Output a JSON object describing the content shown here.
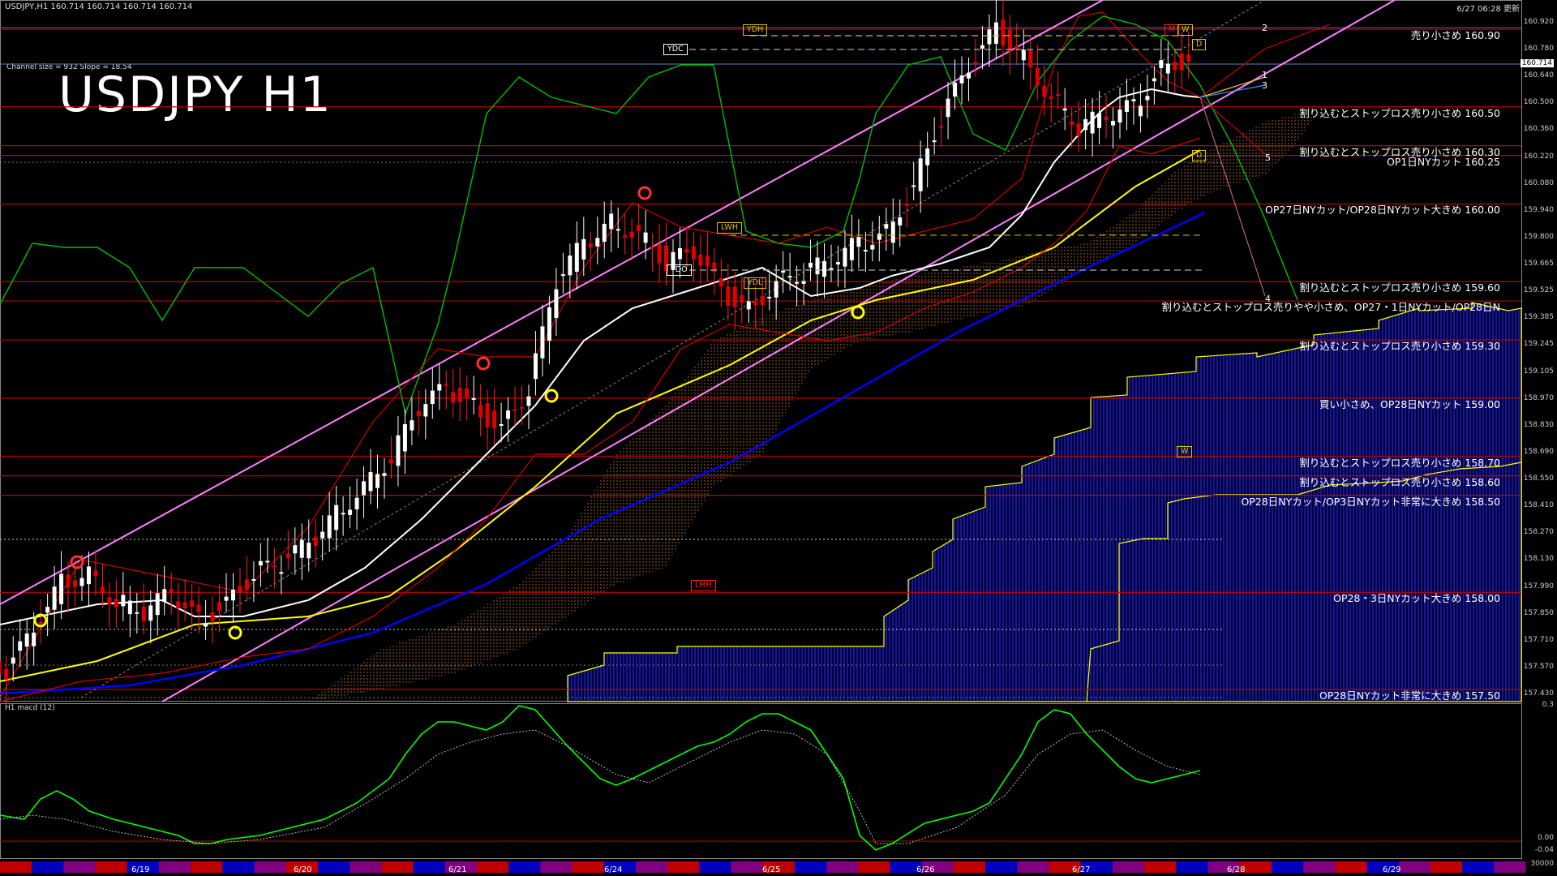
{
  "header": {
    "symbol_line": "USDJPY,H1  160.714 160.714 160.714 160.714",
    "big_title": "USDJPY H1",
    "channel_info": "Channel size = 932 Slope = 18.54",
    "updated": "6/27 06:28 更新"
  },
  "price_axis": {
    "labels": [
      "160.920",
      "160.780",
      "160.640",
      "160.500",
      "160.360",
      "160.220",
      "160.080",
      "159.940",
      "159.800",
      "159.665",
      "159.525",
      "159.385",
      "159.245",
      "159.105",
      "158.970",
      "158.830",
      "158.690",
      "158.550",
      "158.410",
      "158.270",
      "158.130",
      "157.990",
      "157.850",
      "157.710",
      "157.570",
      "157.430"
    ],
    "current": "160.714"
  },
  "macd_axis": {
    "labels": [
      "0.3",
      "0.00",
      "-0.04",
      "30000"
    ]
  },
  "dates": [
    "6/19",
    "6/20",
    "6/21",
    "6/24",
    "6/25",
    "6/26",
    "6/27",
    "6/28",
    "6/29"
  ],
  "levels": [
    {
      "price": 160.9,
      "text": "売り小さめ 160.90"
    },
    {
      "price": 160.5,
      "text": "割り込むとストップロス売り小さめ 160.50"
    },
    {
      "price": 160.3,
      "text": "割り込むとストップロス売り小さめ 160.30"
    },
    {
      "price": 160.25,
      "text": "OP1日NYカット 160.25"
    },
    {
      "price": 160.0,
      "text": "OP27日NYカット/OP28日NYカット大きめ 160.00"
    },
    {
      "price": 159.6,
      "text": "割り込むとストップロス売り小さめ 159.60"
    },
    {
      "price": 159.5,
      "text": "割り込むとストップロス売りやや小さめ、OP27・1日NYカット/OP28日N"
    },
    {
      "price": 159.3,
      "text": "割り込むとストップロス売り小さめ 159.30"
    },
    {
      "price": 159.0,
      "text": "買い小さめ、OP28日NYカット 159.00"
    },
    {
      "price": 158.7,
      "text": "割り込むとストップロス売り小さめ 158.70"
    },
    {
      "price": 158.6,
      "text": "割り込むとストップロス売り小さめ 158.60"
    },
    {
      "price": 158.5,
      "text": "OP28日NYカット/OP3日NYカット非常に大きめ 158.50"
    },
    {
      "price": 158.0,
      "text": "OP28・3日NYカット大きめ 158.00"
    },
    {
      "price": 157.5,
      "text": "OP28日NYカット非常に大きめ 157.50"
    }
  ],
  "tags": {
    "ydh": "YDH",
    "ydc": "YDC",
    "lwh": "LWH",
    "ydo": "YDO",
    "ydl": "YDL",
    "lmh": "LMH",
    "m": "M",
    "w": "W",
    "d_top": "D",
    "d_bot": "D",
    "w_mid": "W"
  },
  "wave_labels": [
    "1",
    "2",
    "3",
    "4",
    "5"
  ],
  "macd_title": "H1 macd (12)",
  "colors": {
    "level": "#c00000",
    "channel": "#ff80ff",
    "ma_fast": "#ffffff",
    "ma_mid": "#ffff00",
    "ma_slow": "#0000ff",
    "chikou": "#00c000",
    "macd_up": "#00ff00",
    "macd_dn": "#ff8080",
    "cloud": "#0000aa"
  },
  "chart_data": {
    "type": "candlestick",
    "symbol": "USDJPY",
    "timeframe": "H1",
    "ylim": [
      157.43,
      160.93
    ],
    "x_range": [
      "6/18",
      "6/29"
    ],
    "close_path": [
      157.6,
      157.8,
      158.05,
      158.1,
      157.95,
      157.9,
      158.0,
      157.85,
      157.95,
      158.1,
      158.15,
      158.25,
      158.4,
      158.55,
      158.7,
      158.95,
      159.05,
      158.95,
      158.85,
      159.05,
      159.6,
      159.8,
      159.9,
      159.85,
      159.7,
      159.75,
      159.55,
      159.45,
      159.6,
      159.65,
      159.7,
      159.8,
      159.85,
      160.1,
      160.45,
      160.7,
      160.9,
      160.75,
      160.55,
      160.4,
      160.45,
      160.5,
      160.7,
      160.75
    ]
  }
}
